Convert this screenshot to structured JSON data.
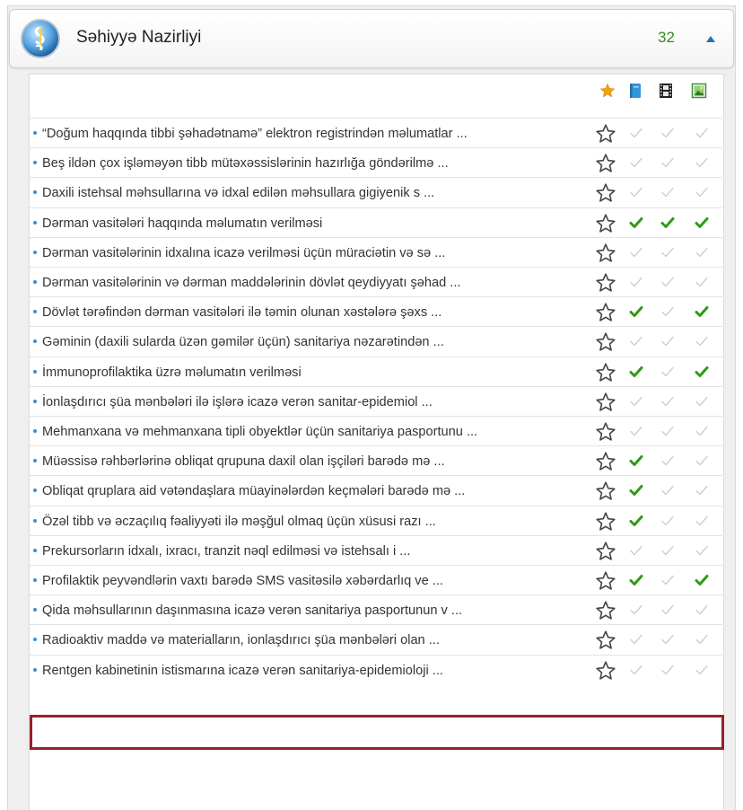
{
  "header": {
    "title": "Səhiyyə Nazirliyi",
    "count": "32"
  },
  "colors": {
    "active_check": "#2e9b16",
    "inactive_check": "#c8d0d6",
    "highlight": "#962326",
    "bullet": "#3b8fd0"
  },
  "columns": [
    "favorite-star-icon",
    "book-icon",
    "film-icon",
    "picture-icon"
  ],
  "rows": [
    {
      "label": "“Doğum haqqında tibbi şəhadətnamə” elektron registrindən məlumatlar ...",
      "checks": [
        false,
        false,
        false
      ]
    },
    {
      "label": "Beş ildən çox işləməyən tibb mütəxəssislərinin hazırlığa göndərilmə ...",
      "checks": [
        false,
        false,
        false
      ]
    },
    {
      "label": "Daxili istehsal məhsullarına və idxal edilən məhsullara gigiyenik s ...",
      "checks": [
        false,
        false,
        false
      ]
    },
    {
      "label": "Dərman vasitələri haqqında məlumatın verilməsi",
      "checks": [
        true,
        true,
        true
      ]
    },
    {
      "label": "Dərman vasitələrinin idxalına icazə verilməsi üçün müraciətin və sə ...",
      "checks": [
        false,
        false,
        false
      ]
    },
    {
      "label": "Dərman vasitələrinin və dərman maddələrinin dövlət qeydiyyatı şəhad ...",
      "checks": [
        false,
        false,
        false
      ]
    },
    {
      "label": "Dövlət tərəfindən dərman vasitələri ilə təmin olunan xəstələrə şəxs ...",
      "checks": [
        true,
        false,
        true
      ]
    },
    {
      "label": "Gəminin (daxili sularda üzən gəmilər üçün) sanitariya nəzarətindən ...",
      "checks": [
        false,
        false,
        false
      ]
    },
    {
      "label": "İmmunoprofilaktika üzrə məlumatın verilməsi",
      "checks": [
        true,
        false,
        true
      ]
    },
    {
      "label": "İonlaşdırıcı şüa mənbələri ilə işlərə icazə verən sanitar-epidemiol ...",
      "checks": [
        false,
        false,
        false
      ]
    },
    {
      "label": "Mehmanxana və mehmanxana tipli obyektlər üçün sanitariya pasportunu ...",
      "checks": [
        false,
        false,
        false
      ]
    },
    {
      "label": "Müəssisə rəhbərlərinə obliqat qrupuna daxil olan işçiləri barədə mə ...",
      "checks": [
        true,
        false,
        false
      ]
    },
    {
      "label": "Obliqat qruplara aid vətəndaşlara müayinələrdən keçmələri barədə mə ...",
      "checks": [
        true,
        false,
        false
      ]
    },
    {
      "label": "Özəl tibb və əczaçılıq fəaliyyəti ilə məşğul olmaq üçün xüsusi razı ...",
      "checks": [
        true,
        false,
        false
      ]
    },
    {
      "label": "Prekursorların idxalı, ixracı, tranzit nəql edilməsi və istehsalı i ...",
      "checks": [
        false,
        false,
        false
      ]
    },
    {
      "label": "Profilaktik peyvəndlərin vaxtı barədə SMS vasitəsilə xəbərdarlıq ve ...",
      "checks": [
        true,
        false,
        true
      ]
    },
    {
      "label": "Qida məhsullarının daşınmasına icazə verən sanitariya pasportunun v ...",
      "checks": [
        false,
        false,
        false
      ]
    },
    {
      "label": "Radioaktiv maddə və materialların, ionlaşdırıcı şüa mənbələri olan ...",
      "checks": [
        false,
        false,
        false
      ]
    },
    {
      "label": "Rentgen kabinetinin istismarına icazə verən sanitariya-epidemioloji ...",
      "checks": [
        false,
        false,
        false
      ]
    }
  ]
}
